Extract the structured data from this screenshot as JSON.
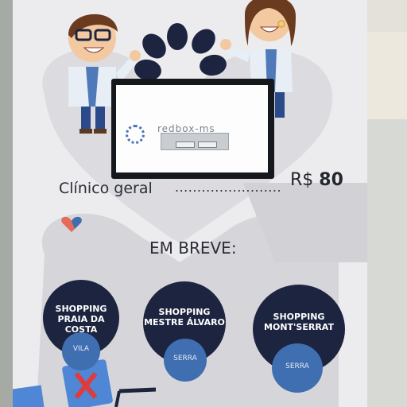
{
  "monitor": {
    "dialog_text": "redbox-ms"
  },
  "pricing": {
    "service_label": "Clínico geral",
    "dots": "........................",
    "currency": "R$",
    "amount": "80"
  },
  "coming_soon": {
    "heading": "EM BREVE:",
    "locations": [
      {
        "line1": "SHOPPING",
        "line2": "PRAIA DA COSTA",
        "city": "VILA"
      },
      {
        "line1": "SHOPPING",
        "line2": "MESTRE ÁLVARO",
        "city": "SERRA"
      },
      {
        "line1": "SHOPPING",
        "line2": "MONT'SERRAT",
        "city": "SERRA"
      }
    ]
  },
  "colors": {
    "banner": "#ecebee",
    "navy": "#1d2440",
    "blue": "#3f6fb0",
    "heart": "#d9d8dc"
  }
}
